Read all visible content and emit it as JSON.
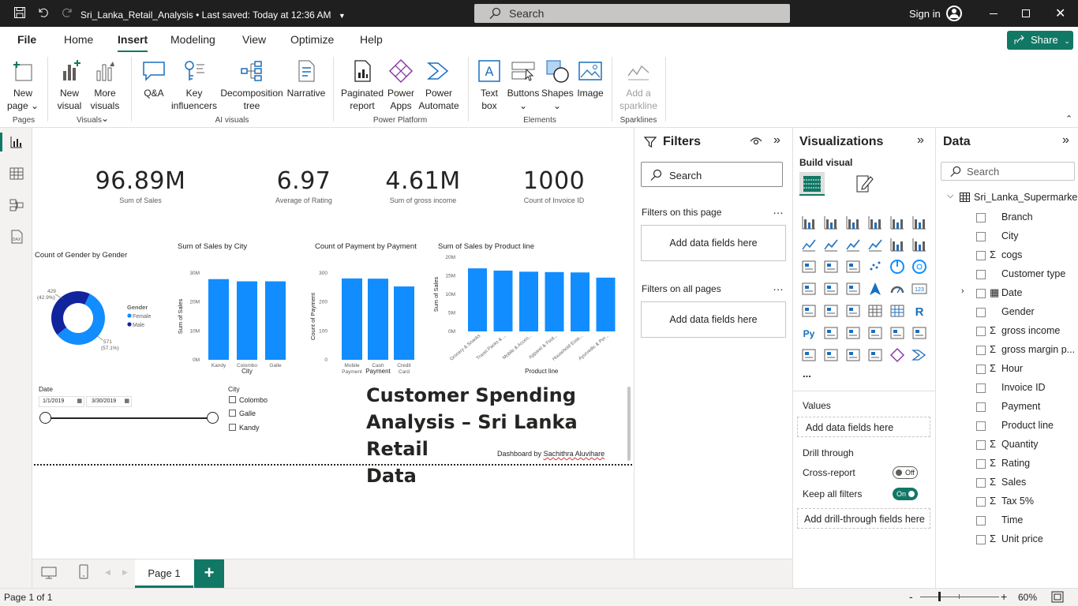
{
  "titlebar": {
    "filename": "Sri_Lanka_Retail_Analysis",
    "saved": "Last saved: Today at 12:36 AM",
    "search_placeholder": "Search",
    "signin": "Sign in"
  },
  "menu": {
    "tabs": [
      "File",
      "Home",
      "Insert",
      "Modeling",
      "View",
      "Optimize",
      "Help"
    ],
    "active": "Insert",
    "share": "Share"
  },
  "ribbon": {
    "buttons": {
      "new_page": [
        "New",
        "page"
      ],
      "new_visual": [
        "New",
        "visual"
      ],
      "more_visuals": [
        "More",
        "visuals"
      ],
      "qa": "Q&A",
      "key_influencers": [
        "Key",
        "influencers"
      ],
      "decomposition_tree": [
        "Decomposition",
        "tree"
      ],
      "narrative": "Narrative",
      "paginated_report": [
        "Paginated",
        "report"
      ],
      "power_apps": [
        "Power",
        "Apps"
      ],
      "power_automate": [
        "Power",
        "Automate"
      ],
      "text_box": [
        "Text",
        "box"
      ],
      "buttons": "Buttons",
      "shapes": "Shapes",
      "image": "Image",
      "sparkline": [
        "Add a",
        "sparkline"
      ]
    },
    "groups": {
      "pages": "Pages",
      "visuals": "Visuals",
      "ai_visuals": "AI visuals",
      "power_platform": "Power Platform",
      "elements": "Elements",
      "sparklines": "Sparklines"
    }
  },
  "kpis": [
    {
      "value": "96.89M",
      "label": "Sum of Sales"
    },
    {
      "value": "6.97",
      "label": "Average of Rating"
    },
    {
      "value": "4.61M",
      "label": "Sum of gross income"
    },
    {
      "value": "1000",
      "label": "Count of Invoice ID"
    }
  ],
  "donut": {
    "title": "Count of Gender by Gender",
    "legend_title": "Gender",
    "female_label": "Female",
    "male_label": "Male",
    "male_count": "429",
    "male_pct": "(42.9%)",
    "female_count": "571",
    "female_pct": "(57.1%)"
  },
  "city_chart": {
    "title": "Sum of Sales by City",
    "ylabel": "Sum of Sales",
    "xlabel": "City",
    "ticks": [
      "30M",
      "20M",
      "10M",
      "0M"
    ],
    "cats": [
      "Kandy",
      "Colombo",
      "Galle"
    ]
  },
  "payment_chart": {
    "title": "Count of Payment by Payment",
    "ylabel": "Count of Payment",
    "xlabel": "Payment",
    "ticks": [
      "300",
      "200",
      "100",
      "0"
    ],
    "cats": [
      [
        "Mobile",
        "Payment"
      ],
      [
        "Cash",
        ""
      ],
      [
        "Credit",
        "Card"
      ]
    ]
  },
  "product_chart": {
    "title": "Sum of Sales by Product line",
    "ylabel": "Sum of Sales",
    "xlabel": "Product line",
    "ticks": [
      "20M",
      "15M",
      "10M",
      "5M",
      "0M"
    ],
    "cats": [
      "Grocery & Snacks",
      "Travel Packs & ...",
      "Mobile & Acces...",
      "Apparel & Foot...",
      "Household Esse...",
      "Ayurvedic & Per..."
    ]
  },
  "chart_data": [
    {
      "type": "pie",
      "title": "Count of Gender by Gender",
      "categories": [
        "Female",
        "Male"
      ],
      "values": [
        571,
        429
      ]
    },
    {
      "type": "bar",
      "title": "Sum of Sales by City",
      "xlabel": "City",
      "ylabel": "Sum of Sales",
      "categories": [
        "Kandy",
        "Colombo",
        "Galle"
      ],
      "values": [
        33,
        32.1,
        32.1
      ],
      "ylim": [
        0,
        34
      ]
    },
    {
      "type": "bar",
      "title": "Count of Payment by Payment",
      "xlabel": "Payment",
      "ylabel": "Count of Payment",
      "categories": [
        "Mobile Payment",
        "Cash",
        "Credit Card"
      ],
      "values": [
        345,
        344,
        311
      ],
      "ylim": [
        0,
        350
      ]
    },
    {
      "type": "bar",
      "title": "Sum of Sales by Product line",
      "xlabel": "Product line",
      "ylabel": "Sum of Sales",
      "categories": [
        "Grocery & Snacks",
        "Travel Packs & ...",
        "Mobile & Acces...",
        "Apparel & Foot...",
        "Household Esse...",
        "Ayurvedic & Per..."
      ],
      "values": [
        17,
        16.4,
        16.1,
        16,
        15.9,
        14.5
      ],
      "ylim": [
        0,
        20
      ]
    }
  ],
  "date_slicer": {
    "title": "Date",
    "from": "1/1/2019",
    "to": "3/30/2019"
  },
  "city_slicer": {
    "title": "City",
    "items": [
      "Colombo",
      "Galle",
      "Kandy"
    ]
  },
  "headline": {
    "line1": "Customer Spending",
    "line2": "Analysis – Sri Lanka Retail",
    "line3": "Data",
    "credit_prefix": "Dashboard by",
    "credit_name": "Sachithra Aluvihare"
  },
  "filters": {
    "title": "Filters",
    "search": "Search",
    "on_page": "Filters on this page",
    "on_all": "Filters on all pages",
    "add_fields": "Add data fields here"
  },
  "visualizations": {
    "title": "Visualizations",
    "build": "Build visual",
    "values": "Values",
    "add_fields": "Add data fields here",
    "drill": "Drill through",
    "cross_report": "Cross-report",
    "cross_state": "Off",
    "keep_filters": "Keep all filters",
    "keep_state": "On",
    "add_drill": "Add drill-through fields here",
    "more": "..."
  },
  "data_pane": {
    "title": "Data",
    "search": "Search",
    "table": "Sri_Lanka_Supermarke...",
    "fields": [
      {
        "name": "Branch",
        "sigma": false
      },
      {
        "name": "City",
        "sigma": false
      },
      {
        "name": "cogs",
        "sigma": true
      },
      {
        "name": "Customer type",
        "sigma": false
      },
      {
        "name": "Date",
        "sigma": false,
        "calendar": true
      },
      {
        "name": "Gender",
        "sigma": false
      },
      {
        "name": "gross income",
        "sigma": true
      },
      {
        "name": "gross margin p...",
        "sigma": true
      },
      {
        "name": "Hour",
        "sigma": true
      },
      {
        "name": "Invoice ID",
        "sigma": false
      },
      {
        "name": "Payment",
        "sigma": false
      },
      {
        "name": "Product line",
        "sigma": false
      },
      {
        "name": "Quantity",
        "sigma": true
      },
      {
        "name": "Rating",
        "sigma": true
      },
      {
        "name": "Sales",
        "sigma": true
      },
      {
        "name": "Tax 5%",
        "sigma": true
      },
      {
        "name": "Time",
        "sigma": false
      },
      {
        "name": "Unit price",
        "sigma": true
      }
    ]
  },
  "pages": {
    "tab": "Page 1",
    "add": "+"
  },
  "status": {
    "page": "Page 1 of 1",
    "zoom": "60%"
  },
  "colors": {
    "accent": "#117865",
    "bar": "#118dff",
    "male": "#12239e"
  }
}
